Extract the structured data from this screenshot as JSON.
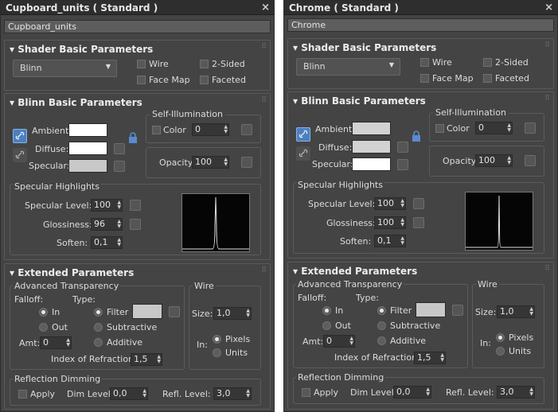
{
  "panels": [
    {
      "window_title": "Cupboard_units  ( Standard )",
      "material_name": "Cupboard_units",
      "shader": {
        "header": "Shader Basic Parameters",
        "type": "Blinn",
        "wire": "Wire",
        "two_sided": "2-Sided",
        "face_map": "Face Map",
        "faceted": "Faceted"
      },
      "blinn": {
        "header": "Blinn Basic Parameters",
        "ambient": "Ambient:",
        "diffuse": "Diffuse:",
        "specular": "Specular:",
        "ambient_color": "#ffffff",
        "diffuse_color": "#ffffff",
        "specular_color": "#c8c8c8",
        "self_illum": "Self-Illumination",
        "color": "Color",
        "self_illum_value": "0",
        "opacity": "Opacity:",
        "opacity_value": "100"
      },
      "highlights": {
        "header": "Specular Highlights",
        "spec_level": "Specular Level:",
        "spec_level_value": "100",
        "glossiness": "Glossiness:",
        "glossiness_value": "96",
        "soften": "Soften:",
        "soften_value": "0,1"
      },
      "extended": {
        "header": "Extended Parameters",
        "adv_transp": "Advanced Transparency",
        "falloff": "Falloff:",
        "type": "Type:",
        "in": "In",
        "out": "Out",
        "filter": "Filter",
        "filter_color": "#c8c8c8",
        "subtractive": "Subtractive",
        "additive": "Additive",
        "amt": "Amt:",
        "amt_value": "0",
        "ior": "Index of Refraction:",
        "ior_value": "1,5",
        "wire": "Wire",
        "size": "Size:",
        "size_value": "1,0",
        "in_label": "In:",
        "pixels": "Pixels",
        "units": "Units",
        "refl_dimming": "Reflection Dimming",
        "apply": "Apply",
        "dim_level": "Dim Level:",
        "dim_level_value": "0,0",
        "refl_level": "Refl. Level:",
        "refl_level_value": "3,0"
      }
    },
    {
      "window_title": "Chrome  ( Standard )",
      "material_name": "Chrome",
      "shader": {
        "header": "Shader Basic Parameters",
        "type": "Blinn",
        "wire": "Wire",
        "two_sided": "2-Sided",
        "face_map": "Face Map",
        "faceted": "Faceted"
      },
      "blinn": {
        "header": "Blinn Basic Parameters",
        "ambient": "Ambient:",
        "diffuse": "Diffuse:",
        "specular": "Specular:",
        "ambient_color": "#d2d2d2",
        "diffuse_color": "#d2d2d2",
        "specular_color": "#ffffff",
        "self_illum": "Self-Illumination",
        "color": "Color",
        "self_illum_value": "0",
        "opacity": "Opacity:",
        "opacity_value": "100"
      },
      "highlights": {
        "header": "Specular Highlights",
        "spec_level": "Specular Level:",
        "spec_level_value": "100",
        "glossiness": "Glossiness:",
        "glossiness_value": "100",
        "soften": "Soften:",
        "soften_value": "0,1"
      },
      "extended": {
        "header": "Extended Parameters",
        "adv_transp": "Advanced Transparency",
        "falloff": "Falloff:",
        "type": "Type:",
        "in": "In",
        "out": "Out",
        "filter": "Filter",
        "filter_color": "#c8c8c8",
        "subtractive": "Subtractive",
        "additive": "Additive",
        "amt": "Amt:",
        "amt_value": "0",
        "ior": "Index of Refraction:",
        "ior_value": "1,5",
        "wire": "Wire",
        "size": "Size:",
        "size_value": "1,0",
        "in_label": "In:",
        "pixels": "Pixels",
        "units": "Units",
        "refl_dimming": "Reflection Dimming",
        "apply": "Apply",
        "dim_level": "Dim Level:",
        "dim_level_value": "0,0",
        "refl_level": "Refl. Level:",
        "refl_level_value": "3,0"
      }
    }
  ],
  "icons": {
    "close": "close-icon",
    "lock": "lock-icon",
    "link_ambient_diffuse": "link-icon",
    "dropdown": "dropdown-arrow-icon",
    "spinner": "spinner-arrows-icon",
    "section_grip": "grip-icon"
  }
}
